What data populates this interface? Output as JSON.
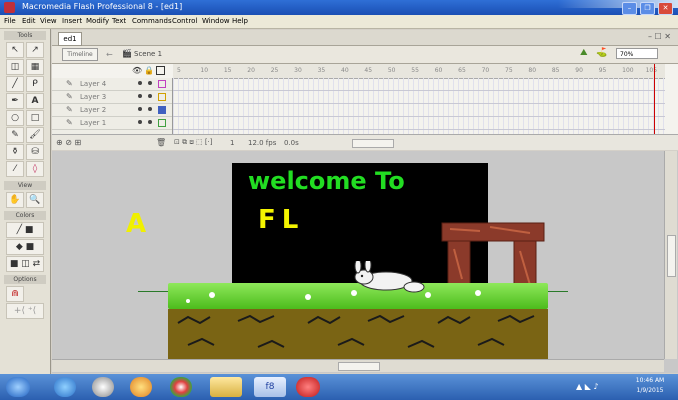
{
  "window": {
    "title": "Macromedia Flash Professional 8 - [ed1]",
    "controls": [
      "–",
      "❐",
      "✕"
    ]
  },
  "menu": [
    "File",
    "Edit",
    "View",
    "Insert",
    "Modify",
    "Text",
    "Commands",
    "Control",
    "Window",
    "Help"
  ],
  "tools": {
    "section_tools": "Tools",
    "section_view": "View",
    "section_colors": "Colors",
    "section_options": "Options",
    "icons": [
      "selection-arrow",
      "subselect-arrow",
      "free-transform",
      "gradient",
      "line",
      "lasso",
      "pen",
      "text",
      "oval",
      "rectangle",
      "pencil",
      "brush",
      "ink-bottle",
      "paint-bucket",
      "eyedropper",
      "eraser"
    ]
  },
  "document_tab": "ed1",
  "editbar": {
    "timeline_button": "Timeline",
    "scene_label": "Scene 1",
    "zoom": "70%"
  },
  "timeline": {
    "layers": [
      {
        "name": "Layer 4"
      },
      {
        "name": "Layer 3"
      },
      {
        "name": "Layer 2"
      },
      {
        "name": "Layer 1"
      }
    ],
    "ruler_ticks": [
      "5",
      "10",
      "15",
      "20",
      "25",
      "30",
      "35",
      "40",
      "45",
      "50",
      "55",
      "60",
      "65",
      "70",
      "75",
      "80",
      "85",
      "90",
      "95",
      "100",
      "105"
    ],
    "status": {
      "frame": "1",
      "fps": "12.0 fps",
      "time": "0.0s"
    }
  },
  "stage": {
    "welcome_text": "welcome To",
    "fl_text": "FL",
    "side_letter": "A"
  },
  "taskbar": {
    "clock_time": "10:46 AM",
    "clock_date": "1/9/2015",
    "apps": [
      "start",
      "ie",
      "media",
      "chrome",
      "folder",
      "flash",
      "opera"
    ]
  },
  "colors": {
    "title_bar": "#1a4fb4",
    "welcome_green": "#22dd22",
    "fl_yellow": "#f4f400",
    "grass": "#4cbc1c",
    "dirt": "#7a6414",
    "arch_wood": "#8b3a2a"
  }
}
